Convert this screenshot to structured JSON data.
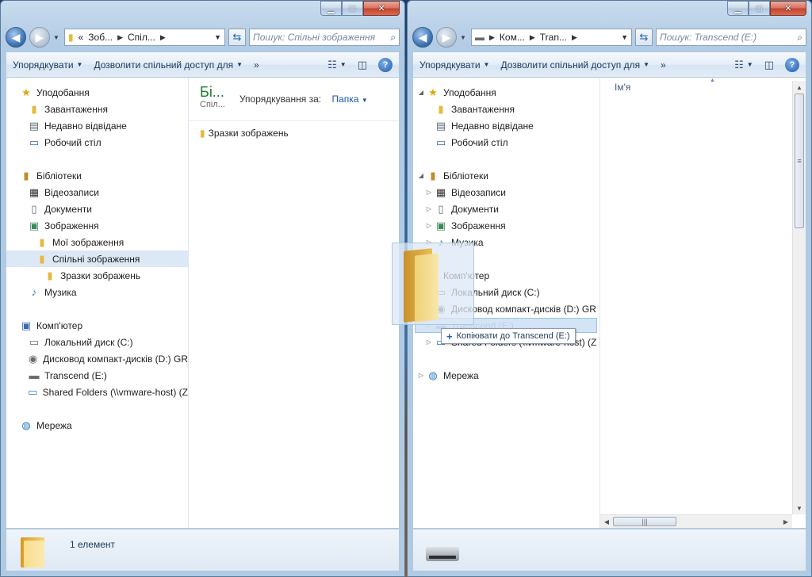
{
  "left_window": {
    "breadcrumb": [
      "«",
      "Зоб...",
      "Спіл..."
    ],
    "search_placeholder": "Пошук: Спільні зображення",
    "toolbar": {
      "organize": "Упорядкувати",
      "share": "Дозволити спільний доступ для",
      "more": "»"
    },
    "nav_tree": [
      {
        "label": "Уподобання",
        "icon": "star",
        "indent": 0,
        "expander": ""
      },
      {
        "label": "Завантаження",
        "icon": "folder",
        "indent": 1,
        "expander": ""
      },
      {
        "label": "Недавно відвідане",
        "icon": "recent",
        "indent": 1,
        "expander": ""
      },
      {
        "label": "Робочий стіл",
        "icon": "desktop",
        "indent": 1,
        "expander": ""
      },
      {
        "gap": true
      },
      {
        "label": "Бібліотеки",
        "icon": "library",
        "indent": 0,
        "expander": ""
      },
      {
        "label": "Відеозаписи",
        "icon": "video",
        "indent": 1,
        "expander": ""
      },
      {
        "label": "Документи",
        "icon": "document",
        "indent": 1,
        "expander": ""
      },
      {
        "label": "Зображення",
        "icon": "pictures",
        "indent": 1,
        "expander": ""
      },
      {
        "label": "Мої зображення",
        "icon": "folder",
        "indent": 2,
        "expander": ""
      },
      {
        "label": "Спільні зображення",
        "icon": "folder",
        "indent": 2,
        "expander": "",
        "selected": true
      },
      {
        "label": "Зразки зображень",
        "icon": "folder",
        "indent": 3,
        "expander": ""
      },
      {
        "label": "Музика",
        "icon": "music",
        "indent": 1,
        "expander": ""
      },
      {
        "gap": true
      },
      {
        "label": "Комп'ютер",
        "icon": "computer",
        "indent": 0,
        "expander": ""
      },
      {
        "label": "Локальний диск (C:)",
        "icon": "drive",
        "indent": 1,
        "expander": ""
      },
      {
        "label": "Дисковод компакт-дисків (D:) GR",
        "icon": "cd",
        "indent": 1,
        "expander": ""
      },
      {
        "label": "Transcend (E:)",
        "icon": "usb",
        "indent": 1,
        "expander": ""
      },
      {
        "label": "Shared Folders (\\\\vmware-host) (Z",
        "icon": "netdrive",
        "indent": 1,
        "expander": ""
      },
      {
        "gap": true
      },
      {
        "label": "Мережа",
        "icon": "network",
        "indent": 0,
        "expander": ""
      }
    ],
    "library_title": "Бі...",
    "library_sub": "Спіл...",
    "arrange_label": "Упорядкування за:",
    "arrange_value": "Папка",
    "files": [
      "Зразки зображень"
    ],
    "status_text": "1 елемент"
  },
  "right_window": {
    "breadcrumb": [
      "Ком...",
      "Tran..."
    ],
    "search_placeholder": "Пошук: Transcend (E:)",
    "toolbar": {
      "organize": "Упорядкувати",
      "share": "Дозволити спільний доступ для",
      "more": "»"
    },
    "nav_tree": [
      {
        "label": "Уподобання",
        "icon": "star",
        "indent": 0,
        "expander": "◢"
      },
      {
        "label": "Завантаження",
        "icon": "folder",
        "indent": 1,
        "expander": ""
      },
      {
        "label": "Недавно відвідане",
        "icon": "recent",
        "indent": 1,
        "expander": ""
      },
      {
        "label": "Робочий стіл",
        "icon": "desktop",
        "indent": 1,
        "expander": ""
      },
      {
        "gap": true
      },
      {
        "label": "Бібліотеки",
        "icon": "library",
        "indent": 0,
        "expander": "◢"
      },
      {
        "label": "Відеозаписи",
        "icon": "video",
        "indent": 1,
        "expander": "▷"
      },
      {
        "label": "Документи",
        "icon": "document",
        "indent": 1,
        "expander": "▷"
      },
      {
        "label": "Зображення",
        "icon": "pictures",
        "indent": 1,
        "expander": "▷"
      },
      {
        "label": "Музика",
        "icon": "music",
        "indent": 1,
        "expander": "▷"
      },
      {
        "gap": true
      },
      {
        "label": "Комп'ютер",
        "icon": "computer",
        "indent": 0,
        "expander": "◢"
      },
      {
        "label": "Локальний диск (C:)",
        "icon": "drive",
        "indent": 1,
        "expander": "▷"
      },
      {
        "label": "Дисковод компакт-дисків (D:) GR",
        "icon": "cd",
        "indent": 1,
        "expander": "▷"
      },
      {
        "label": "Transcend (E:)",
        "icon": "usb",
        "indent": 1,
        "expander": "▷"
      },
      {
        "label": "Shared Folders (\\\\vmware-host) (Z",
        "icon": "netdrive",
        "indent": 1,
        "expander": "▷"
      },
      {
        "gap": true
      },
      {
        "label": "Мережа",
        "icon": "network",
        "indent": 0,
        "expander": "▷"
      }
    ],
    "column_name": "Ім'я"
  },
  "drag_tooltip": "Копіювати до Transcend (E:)"
}
